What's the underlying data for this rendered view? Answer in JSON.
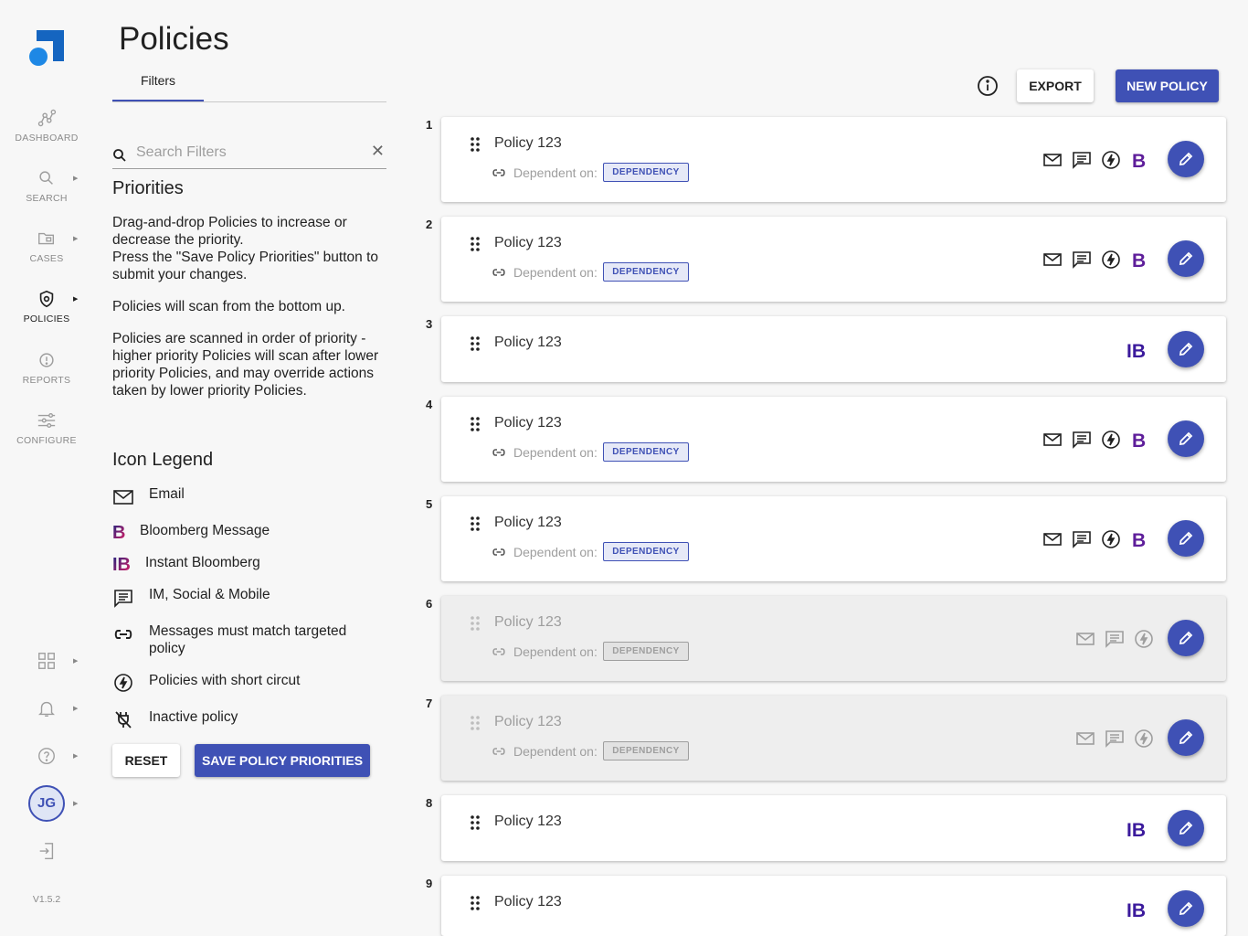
{
  "nav": {
    "items": [
      {
        "label": "DASHBOARD"
      },
      {
        "label": "SEARCH"
      },
      {
        "label": "CASES"
      },
      {
        "label": "POLICIES"
      },
      {
        "label": "REPORTS"
      },
      {
        "label": "CONFIGURE"
      }
    ],
    "avatar": "JG",
    "version": "V1.5.2"
  },
  "page": {
    "title": "Policies",
    "filters_tab": "Filters",
    "search_placeholder": "Search Filters",
    "priorities_heading": "Priorities",
    "paragraphs": [
      "Drag-and-drop Policies to increase or decrease the priority.",
      "Press the \"Save Policy Priorities\" button to submit your changes.",
      "Policies will scan from the bottom up.",
      "Policies are scanned in order of priority - higher priority Policies will scan after lower priority Policies, and may override actions taken by lower priority Policies."
    ],
    "legend_heading": "Icon Legend",
    "legend": [
      {
        "icon": "email-icon",
        "label": "Email"
      },
      {
        "icon": "bloomberg-message-icon",
        "label": "Bloomberg Message"
      },
      {
        "icon": "instant-bloomberg-icon",
        "label": "Instant Bloomberg"
      },
      {
        "icon": "im-social-mobile-icon",
        "label": "IM, Social & Mobile"
      },
      {
        "icon": "link-icon",
        "label": "Messages must match targeted policy"
      },
      {
        "icon": "short-circuit-icon",
        "label": "Policies with short circut"
      },
      {
        "icon": "inactive-policy-icon",
        "label": "Inactive policy"
      }
    ],
    "reset_label": "RESET",
    "save_label": "SAVE POLICY PRIORITIES"
  },
  "header": {
    "export_label": "EXPORT",
    "new_policy_label": "NEW POLICY"
  },
  "policies": [
    {
      "num": "1",
      "name": "Policy 123",
      "dependent_label": "Dependent on:",
      "dependency": "DEPENDENCY",
      "icons": [
        "email",
        "im",
        "short-circuit",
        "bloomberg"
      ],
      "inactive": false
    },
    {
      "num": "2",
      "name": "Policy 123",
      "dependent_label": "Dependent on:",
      "dependency": "DEPENDENCY",
      "icons": [
        "email",
        "im",
        "short-circuit",
        "bloomberg"
      ],
      "inactive": false
    },
    {
      "num": "3",
      "name": "Policy 123",
      "dependent_label": null,
      "dependency": null,
      "icons": [
        "instant-bloomberg"
      ],
      "inactive": false
    },
    {
      "num": "4",
      "name": "Policy 123",
      "dependent_label": "Dependent on:",
      "dependency": "DEPENDENCY",
      "icons": [
        "email",
        "im",
        "short-circuit",
        "bloomberg"
      ],
      "inactive": false
    },
    {
      "num": "5",
      "name": "Policy 123",
      "dependent_label": "Dependent on:",
      "dependency": "DEPENDENCY",
      "icons": [
        "email",
        "im",
        "short-circuit",
        "bloomberg"
      ],
      "inactive": false
    },
    {
      "num": "6",
      "name": "Policy 123",
      "dependent_label": "Dependent on:",
      "dependency": "DEPENDENCY",
      "icons": [
        "email",
        "im",
        "short-circuit"
      ],
      "inactive": true
    },
    {
      "num": "7",
      "name": "Policy 123",
      "dependent_label": "Dependent on:",
      "dependency": "DEPENDENCY",
      "icons": [
        "email",
        "im",
        "short-circuit"
      ],
      "inactive": true
    },
    {
      "num": "8",
      "name": "Policy 123",
      "dependent_label": null,
      "dependency": null,
      "icons": [
        "instant-bloomberg"
      ],
      "inactive": false
    },
    {
      "num": "9",
      "name": "Policy 123",
      "dependent_label": null,
      "dependency": null,
      "icons": [
        "instant-bloomberg"
      ],
      "inactive": false
    }
  ],
  "colors": {
    "primary": "#3f51b5",
    "logo_blue": "#1e88e5",
    "logo_navy": "#1565c0",
    "bloomberg_purple": "#6a1b9a"
  }
}
